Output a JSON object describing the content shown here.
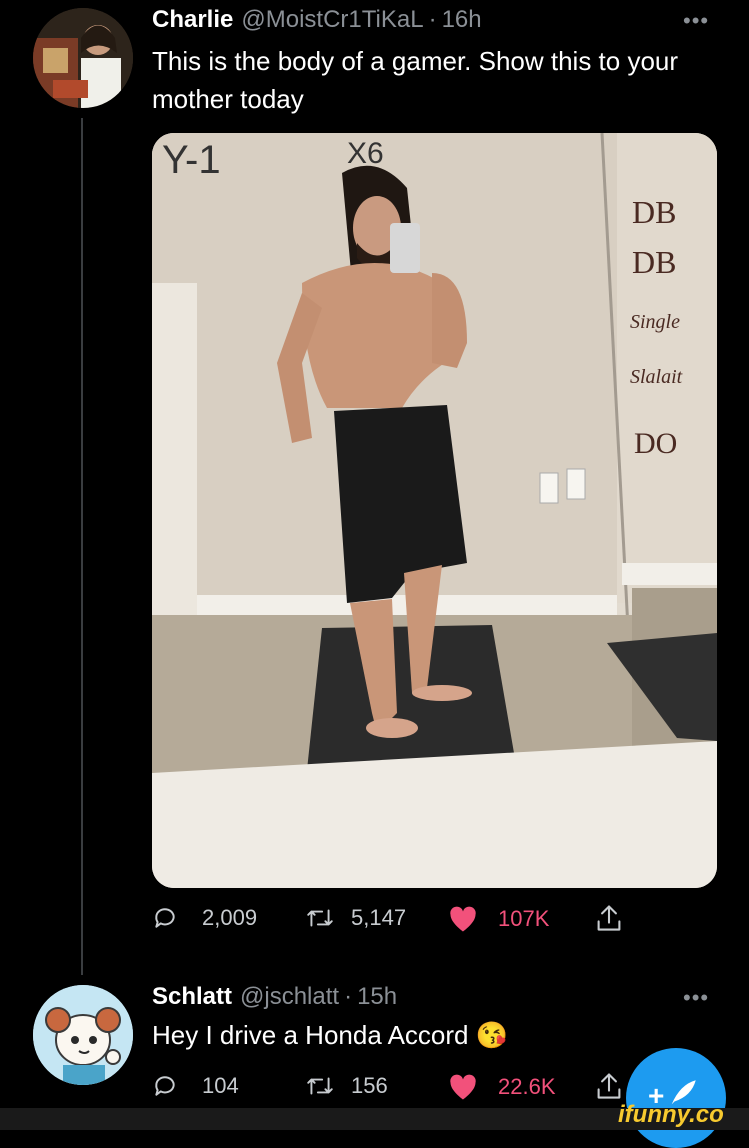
{
  "tweet": {
    "author": "Charlie",
    "handle": "@MoistCr1TiKaL",
    "separator": "·",
    "time": "16h",
    "more": "•••",
    "text": "This is the body of a gamer. Show this to your mother today",
    "stats": {
      "replies": "2,009",
      "retweets": "5,147",
      "likes": "107K"
    },
    "photo": {
      "mirror_writing_top": [
        "Y-1",
        "X6"
      ],
      "mirror_writing_right": [
        "DB",
        "DB",
        "Single",
        "Slalait",
        "DO"
      ]
    }
  },
  "reply": {
    "author": "Schlatt",
    "handle": "@jschlatt",
    "separator": "·",
    "time": "15h",
    "more": "•••",
    "text": "Hey I drive a Honda Accord 😘",
    "stats": {
      "replies": "104",
      "retweets": "156",
      "likes": "22.6K"
    }
  },
  "compose_button": {
    "icon": "compose-icon",
    "glyph": "+"
  },
  "watermark": "ifunny.co",
  "colors": {
    "background": "#000000",
    "like": "#f2517b",
    "accent": "#1d9bf0",
    "muted": "#8b9096"
  }
}
